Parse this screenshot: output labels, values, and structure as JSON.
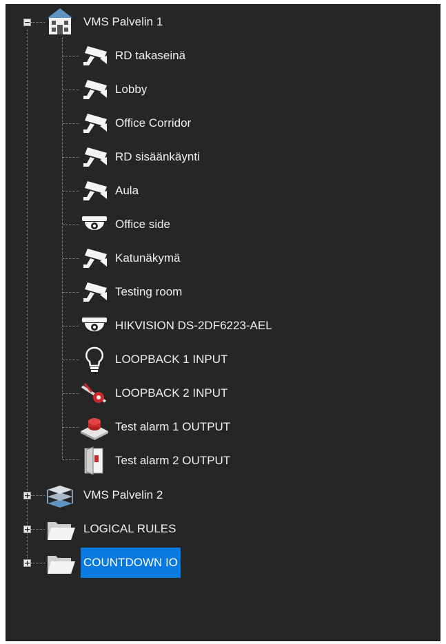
{
  "tree": {
    "root1": {
      "label": "VMS Palvelin 1",
      "expander": "−",
      "children": [
        {
          "label": "RD takaseinä",
          "icon": "bullet-camera-icon"
        },
        {
          "label": "Lobby",
          "icon": "bullet-camera-icon"
        },
        {
          "label": "Office Corridor",
          "icon": "bullet-camera-icon"
        },
        {
          "label": "RD sisäänkäynti",
          "icon": "bullet-camera-icon"
        },
        {
          "label": "Aula",
          "icon": "bullet-camera-icon"
        },
        {
          "label": "Office side",
          "icon": "dome-camera-icon"
        },
        {
          "label": "Katunäkymä",
          "icon": "bullet-camera-icon"
        },
        {
          "label": "Testing room",
          "icon": "bullet-camera-icon"
        },
        {
          "label": "HIKVISION DS-2DF6223-AEL",
          "icon": "dome-camera-icon"
        },
        {
          "label": "LOOPBACK 1 INPUT",
          "icon": "light-bulb-icon"
        },
        {
          "label": "LOOPBACK 2 INPUT",
          "icon": "input-plug-icon"
        },
        {
          "label": "Test alarm 1 OUTPUT",
          "icon": "alarm-button-icon"
        },
        {
          "label": "Test alarm 2 OUTPUT",
          "icon": "door-contact-icon"
        }
      ]
    },
    "root2": {
      "label": "VMS Palvelin 2",
      "expander": "+"
    },
    "root3": {
      "label": "LOGICAL RULES",
      "expander": "+"
    },
    "root4": {
      "label": "COUNTDOWN IO",
      "expander": "+",
      "selected": true
    }
  },
  "colors": {
    "background": "#262626",
    "selection": "#0a7ae3",
    "text": "#f0f0f0"
  }
}
